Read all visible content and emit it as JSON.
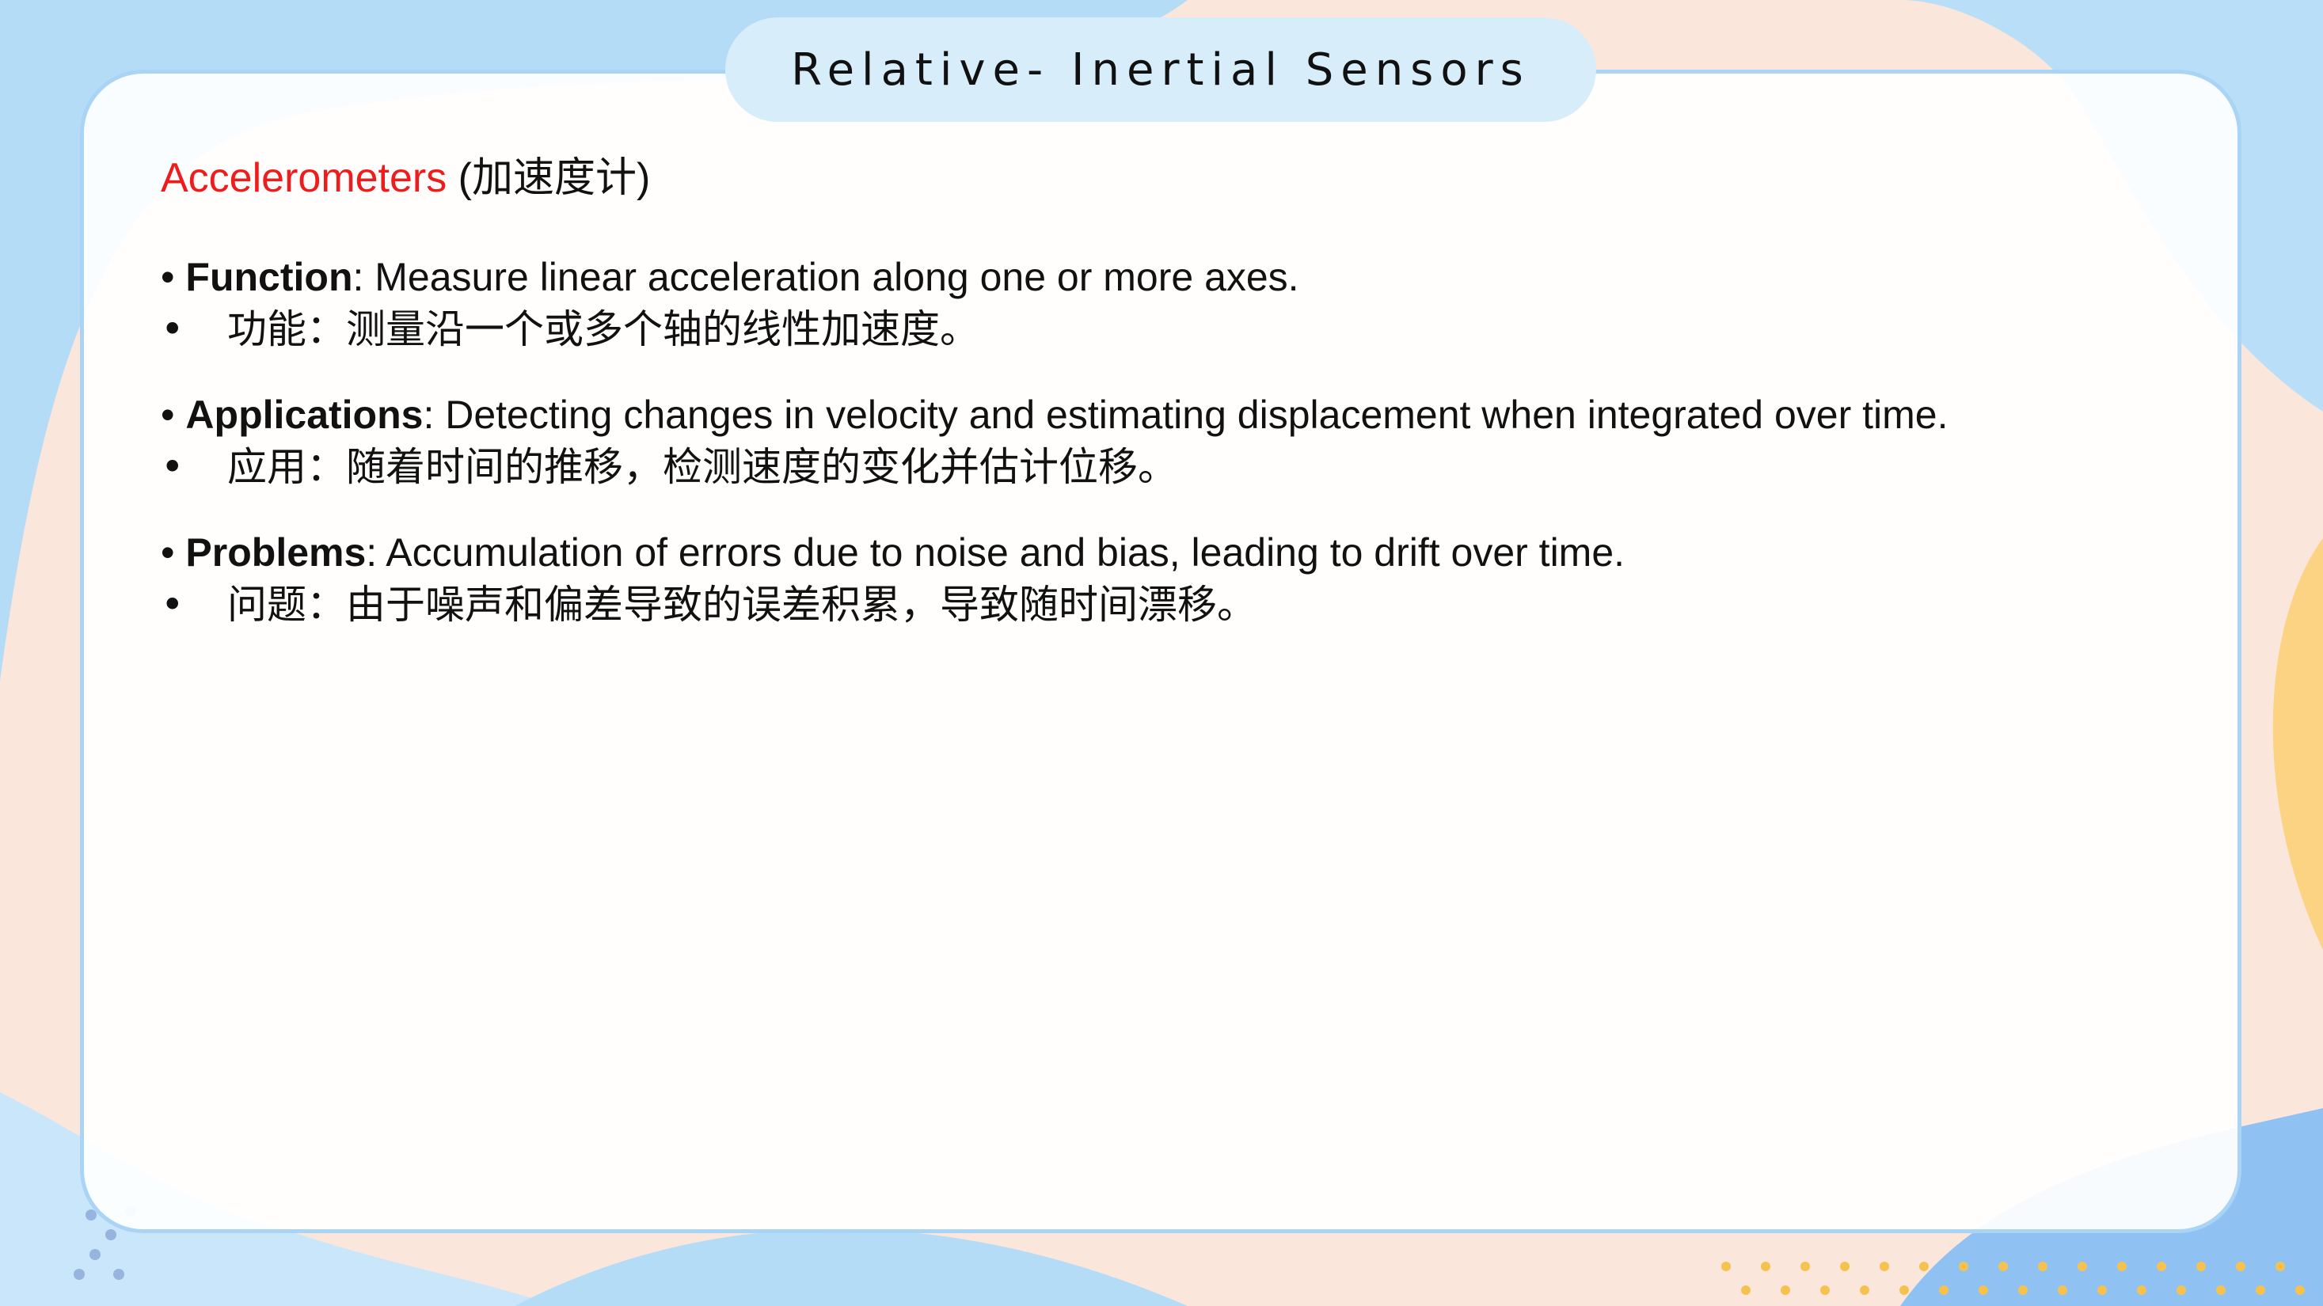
{
  "slide": {
    "title": "Relative- Inertial Sensors",
    "heading": {
      "accent": "Accelerometers",
      "rest": " (加速度计)"
    },
    "items": [
      {
        "label": "Function",
        "text": ": Measure linear acceleration along one or more axes.",
        "zh": "功能：测量沿一个或多个轴的线性加速度。"
      },
      {
        "label": "Applications",
        "text": ": Detecting changes in velocity and estimating displacement when integrated over time.",
        "zh": "应用：随着时间的推移，检测速度的变化并估计位移。"
      },
      {
        "label": "Problems",
        "text": ": Accumulation of errors due to noise and bias, leading to drift over time.",
        "zh": "问题：由于噪声和偏差导致的误差积累，导致随时间漂移。"
      }
    ],
    "bullet": "•",
    "colors": {
      "accent": "#ee1c1c",
      "card_border": "#a9d4f5",
      "title_pill": "#d7edf9"
    }
  }
}
